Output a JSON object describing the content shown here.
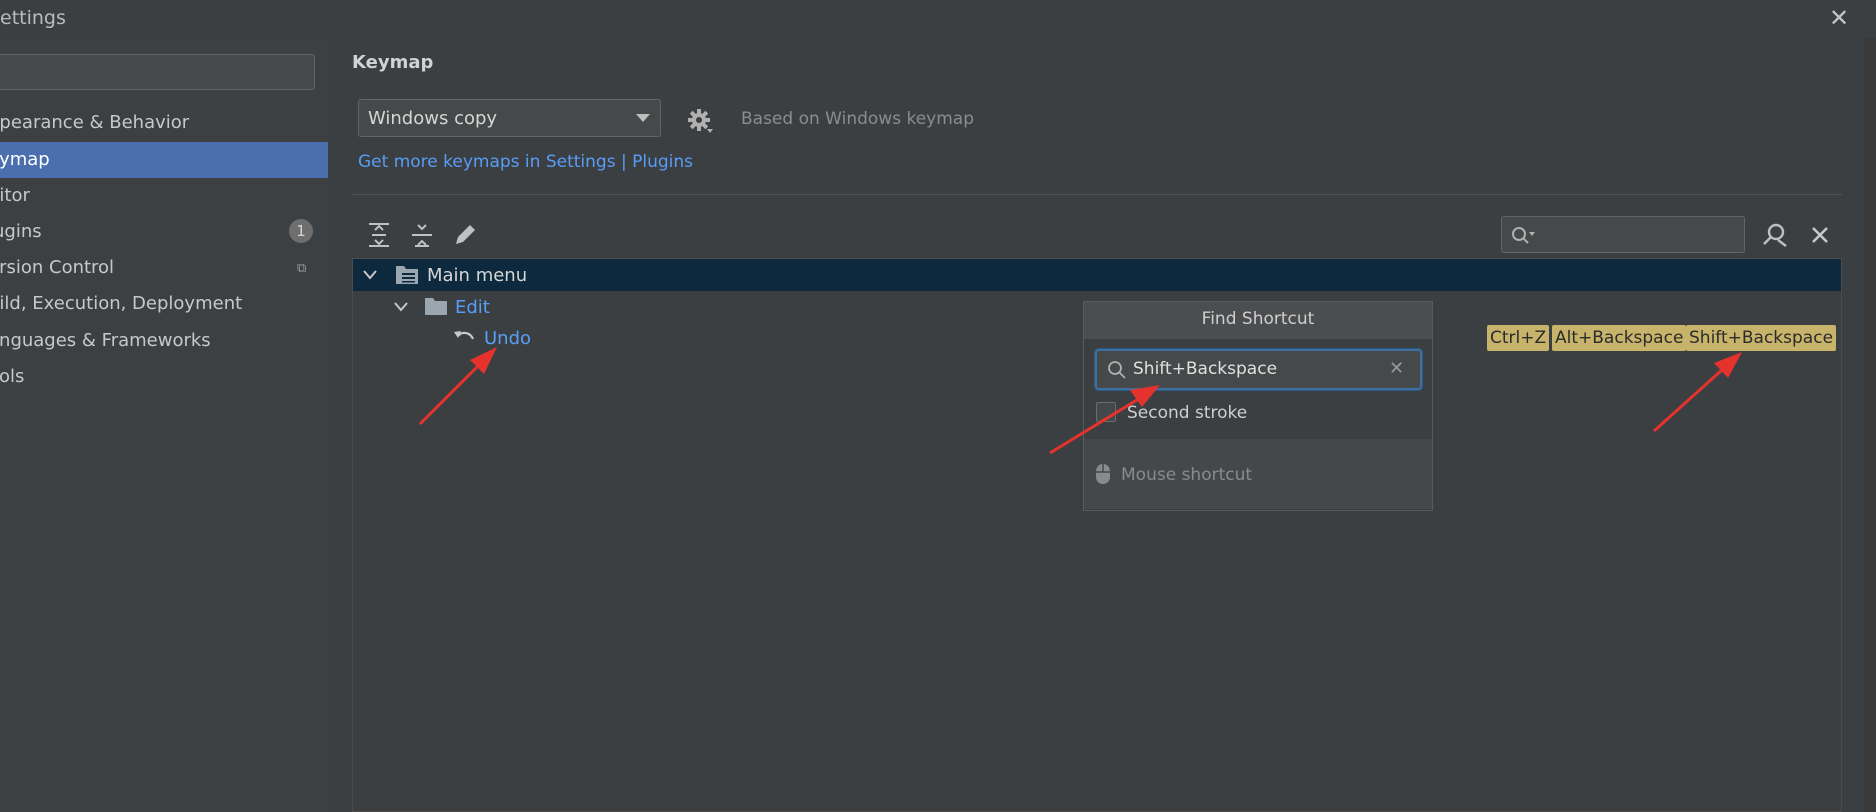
{
  "window": {
    "title": "ettings"
  },
  "sidebar": {
    "items": [
      {
        "label": "ppearance & Behavior"
      },
      {
        "label": "eymap"
      },
      {
        "label": "ditor"
      },
      {
        "label": "lugins"
      },
      {
        "label": "ersion Control"
      },
      {
        "label": "uild, Execution, Deployment"
      },
      {
        "label": "anguages & Frameworks"
      },
      {
        "label": "ools"
      }
    ],
    "plugins_badge": "1",
    "active_index": 1
  },
  "main": {
    "heading": "Keymap",
    "keymap_select_value": "Windows copy",
    "based_on": "Based on Windows keymap",
    "get_more_link": "Get more keymaps in Settings | Plugins"
  },
  "tree": {
    "main_menu": "Main menu",
    "edit": "Edit",
    "undo": "Undo",
    "shortcuts": [
      "Ctrl+Z",
      "Alt+Backspace",
      "Shift+Backspace"
    ]
  },
  "find_shortcut": {
    "title": "Find Shortcut",
    "input_value": "Shift+Backspace",
    "second_stroke_label": "Second stroke",
    "mouse_shortcut_label": "Mouse shortcut"
  },
  "colors": {
    "accent": "#4b6eaf",
    "link": "#589df6",
    "shortcut_highlight": "#c7b46a",
    "annotation_arrow": "#e5322d"
  },
  "icons": {
    "toolbar": [
      "expand-all-icon",
      "collapse-all-icon",
      "edit-icon"
    ],
    "search_toolbar": [
      "find-shortcut-icon",
      "close-icon"
    ]
  }
}
